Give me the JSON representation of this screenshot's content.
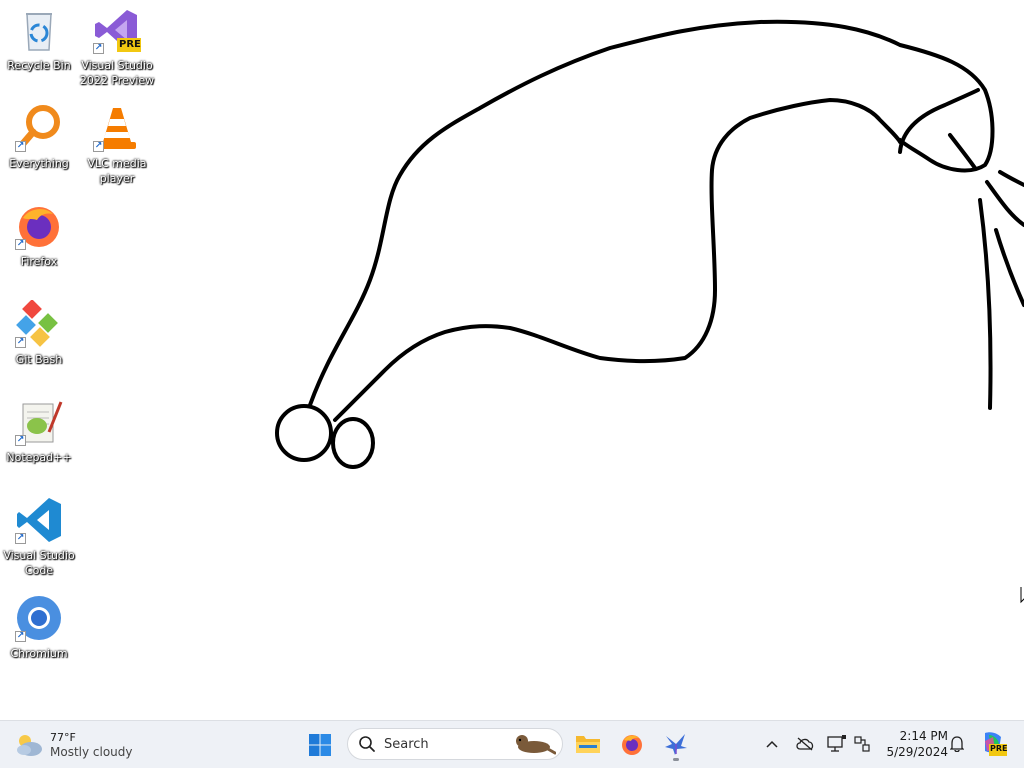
{
  "desktop": {
    "icons": [
      {
        "name": "recycle-bin",
        "label": "Recycle Bin"
      },
      {
        "name": "visual-studio-2022-preview",
        "label": "Visual Studio 2022 Preview",
        "badge": "PRE"
      },
      {
        "name": "everything",
        "label": "Everything"
      },
      {
        "name": "vlc-media-player",
        "label": "VLC media player"
      },
      {
        "name": "firefox",
        "label": "Firefox"
      },
      {
        "name": "git-bash",
        "label": "Git Bash"
      },
      {
        "name": "notepad-plus-plus",
        "label": "Notepad++"
      },
      {
        "name": "visual-studio-code",
        "label": "Visual Studio Code"
      },
      {
        "name": "chromium",
        "label": "Chromium"
      }
    ],
    "drawing": {
      "stroke_color": "#000000",
      "description_icon": "freehand-drawing"
    }
  },
  "taskbar": {
    "weather": {
      "temperature": "77°F",
      "condition": "Mostly cloudy",
      "icon": "cloud-sun-icon"
    },
    "search": {
      "placeholder": "Search",
      "icon": "search-icon"
    },
    "pinned": [
      {
        "name": "start",
        "icon": "windows-logo-icon"
      },
      {
        "name": "file-explorer",
        "icon": "folder-icon"
      },
      {
        "name": "firefox",
        "icon": "firefox-icon"
      },
      {
        "name": "paint-app",
        "icon": "feather-icon",
        "running": true
      }
    ],
    "tray": {
      "chevron": "chevron-up-icon",
      "onedrive": "cloud-offline-icon",
      "display": "monitor-icon",
      "network": "network-icon"
    },
    "clock": {
      "time": "2:14 PM",
      "date": "5/29/2024"
    },
    "notifications_icon": "bell-icon",
    "copilot": {
      "icon": "copilot-icon",
      "badge": "PRE"
    }
  },
  "colors": {
    "taskbar_bg": "#eef1f6",
    "accent_blue": "#0067c0",
    "desktop_bg": "#ffffff"
  }
}
